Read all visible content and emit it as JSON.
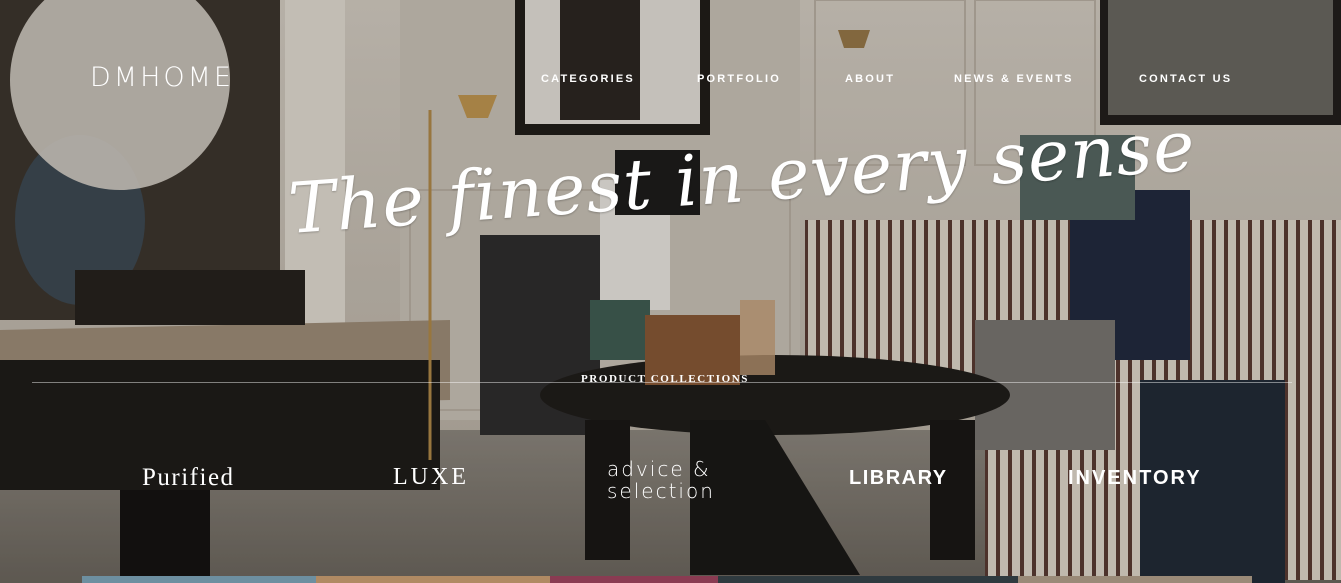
{
  "brand": {
    "name": "DMHOME"
  },
  "nav": {
    "items": [
      {
        "label": "CATEGORIES"
      },
      {
        "label": "PORTFOLIO"
      },
      {
        "label": "ABOUT"
      },
      {
        "label": "NEWS & EVENTS"
      },
      {
        "label": "CONTACT US"
      }
    ]
  },
  "hero": {
    "tagline": "The finest in every sense",
    "collections_title": "PRODUCT COLLECTIONS",
    "collections": [
      {
        "label": "Purified"
      },
      {
        "label": "LUXE"
      },
      {
        "label_line1": "advice &",
        "label_line2": "selection"
      },
      {
        "label": "LIBRARY"
      },
      {
        "label": "INVENTORY"
      }
    ],
    "collection_colors": [
      "#6d8fa0",
      "#b08a63",
      "#8a3b52",
      "#2f3a3f",
      "#9a8a78"
    ]
  },
  "colors": {
    "text": "#ffffff",
    "accent_bar_1": "#6d8fa0",
    "accent_bar_2": "#b08a63",
    "accent_bar_3": "#8a3b52"
  }
}
